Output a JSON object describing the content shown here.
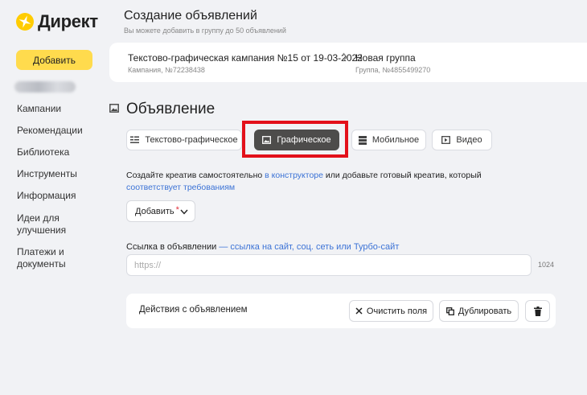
{
  "sidebar": {
    "logo_text": "Директ",
    "add_button_label": "Добавить",
    "nav_items": [
      {
        "label": "Кампании"
      },
      {
        "label": "Рекомендации"
      },
      {
        "label": "Библиотека"
      },
      {
        "label": "Инструменты"
      },
      {
        "label": "Информация"
      },
      {
        "label": "Идеи для улучшения"
      },
      {
        "label": "Платежи и документы"
      }
    ]
  },
  "header": {
    "title": "Создание объявлений",
    "subtitle": "Вы можете добавить в группу до 50 объявлений"
  },
  "breadcrumb": {
    "campaign_title": "Текстово-графическая кампания №15 от 19-03-2022",
    "campaign_sub": "Кампания, №72238438",
    "group_title": "Новая группа",
    "group_sub": "Группа, №4855499270"
  },
  "ad": {
    "section_title": "Объявление",
    "tabs": [
      {
        "label": "Текстово-графическое",
        "icon": "text-lines-icon"
      },
      {
        "label": "Графическое",
        "icon": "image-icon",
        "active": true
      },
      {
        "label": "Мобильное",
        "icon": "mobile-stack-icon"
      },
      {
        "label": "Видео",
        "icon": "play-icon"
      }
    ],
    "desc_before": "Создайте креатив самостоятельно ",
    "desc_link1": "в конструкторе",
    "desc_middle": " или добавьте готовый креатив, который ",
    "desc_link2": "соответствует требованиям",
    "add_dropdown_label": "Добавить",
    "required_mark": "*",
    "url_label": "Ссылка в объявлении",
    "url_hint": " — ссылка на сайт, соц. сеть или Турбо-сайт",
    "url_placeholder": "https://",
    "url_value": "",
    "char_limit": "1024"
  },
  "actions": {
    "label": "Действия с объявлением",
    "clear_label": "Очистить поля",
    "duplicate_label": "Дублировать"
  },
  "colors": {
    "accent_yellow": "#ffdb4d",
    "active_tab": "#4d4c4b",
    "link": "#3c73d6",
    "highlight_red": "#e3101a",
    "background": "#f1f2f5"
  }
}
